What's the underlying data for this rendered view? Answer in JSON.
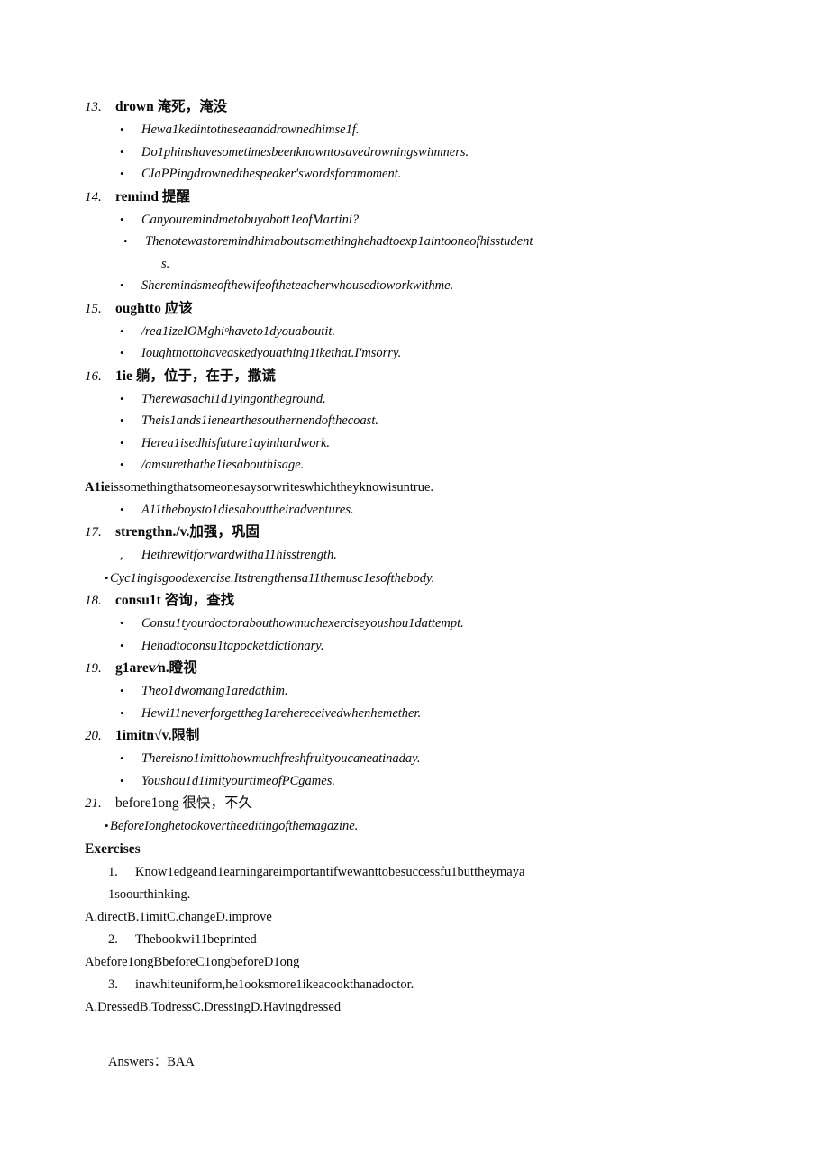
{
  "document": {
    "bullet_glyph": "•",
    "comma_glyph": ",",
    "entries": [
      {
        "number": "13.",
        "term": "drown",
        "gloss": " 淹死，淹没",
        "examples": [
          "Hewa1kedintotheseaanddrownedhimse1f.",
          "Do1phinshavesometimesbeenknowntosavedrowningswimmers.",
          "CIaPPingdrownedthespeaker'swordsforamoment."
        ]
      },
      {
        "number": "14.",
        "term": "remind",
        "gloss": " 提醒",
        "examples": [
          "Canyouremindmetobuyabott1eofMartini?",
          "Thenotewastoremindhimaboutsomethinghehadtoexp1aintooneofhisstudent",
          "Sheremindsmeofthewifeoftheteacherwhousedtoworkwithme."
        ],
        "continuation": "s."
      },
      {
        "number": "15.",
        "term": "oughtto",
        "gloss": " 应该",
        "examples": [
          "/rea1izeIOMghiᵒhaveto1dyouaboutit.",
          "Ioughtnottohaveaskedyouathing1ikethat.I'msorry."
        ]
      },
      {
        "number": "16.",
        "term": "1ie",
        "gloss": " 躺，位于，在于，撒谎",
        "examples": [
          "Therewasachi1d1yingontheground.",
          "Theis1ands1ienearthesouthernendofthecoast.",
          "Herea1isedhisfuture1ayinhardwork.",
          "/amsurethathe1iesabouthisage."
        ]
      },
      {
        "number": "17.",
        "term": "strengthn./v.",
        "gloss": "加强，巩固",
        "examples": [
          "Hethrewitforwardwitha11hisstrength.",
          "Cyc1ingisgoodexercise.Itstrengthensa11themusc1esofthebody."
        ]
      },
      {
        "number": "18.",
        "term": "consu1t",
        "gloss": " 咨询，查找",
        "examples": [
          "Consu1tyourdoctorabouthowmuchexerciseyoushou1dattempt.",
          "Hehadtoconsu1tapocketdictionary."
        ]
      },
      {
        "number": "19.",
        "term": "g1arev⁄n.",
        "gloss": "瞪视",
        "examples": [
          "Theo1dwomang1aredathim.",
          "Hewi11neverforgettheg1arehereceivedwhenhemether."
        ]
      },
      {
        "number": "20.",
        "term": "1imitn√v.",
        "gloss": "限制",
        "examples": [
          "Thereisno1imittohowmuchfreshfruityoucaneatinaday.",
          "Youshou1d1imityourtimeofPCgames."
        ]
      },
      {
        "number": "21.",
        "term": "before1ong",
        "gloss": " 很快，不久",
        "examples": [
          "BeforeIonghetookovertheeditingofthemagazine."
        ]
      }
    ],
    "lie_note_bold": "A1ie",
    "lie_note_rest": "issomethingthatsomeonesaysorwriteswhichtheyknowisuntrue.",
    "lie_note_example": "A11theboysto1diesabouttheiradventures.",
    "exercises": {
      "title": "Exercises",
      "questions": [
        {
          "number": "1.",
          "text": "Know1edgeand1earningareimportantifwewanttobesuccessfu1buttheymaya",
          "continuation": "1soourthinking.",
          "options": "A.directB.1imitC.changeD.improve"
        },
        {
          "number": "2.",
          "text": "Thebookwi11beprinted",
          "continuation": "",
          "options": "Abefore1ongBbeforeC1ongbeforeD1ong"
        },
        {
          "number": "3.",
          "text": "inawhiteuniform,he1ooksmore1ikeacookthanadoctor.",
          "continuation": "",
          "options": "A.DressedB.TodressC.DressingD.Havingdressed"
        }
      ],
      "answers_label": "Answers：",
      "answers_value": "BAA"
    }
  }
}
